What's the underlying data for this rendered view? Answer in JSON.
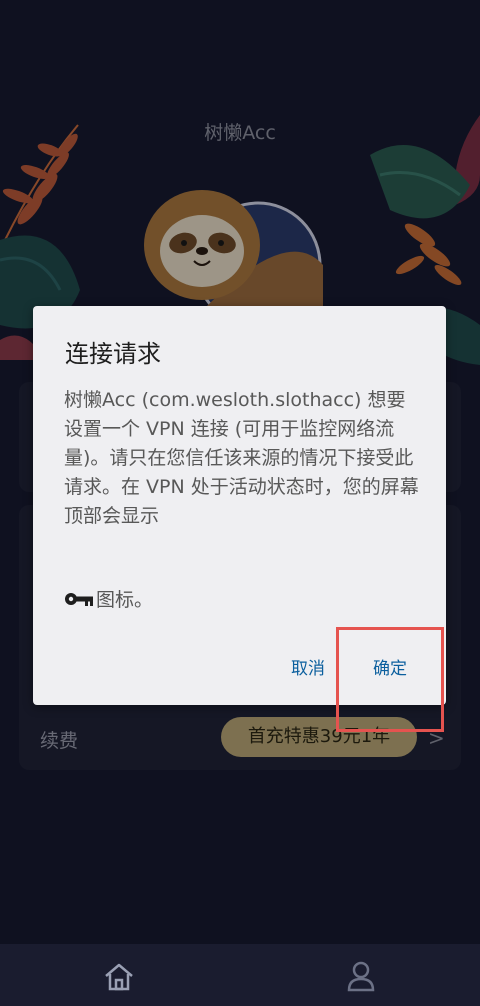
{
  "app": {
    "title": "树懒Acc"
  },
  "background": {
    "renew_label": "续费",
    "promo_label": "首充特惠39元1年"
  },
  "dialog": {
    "title": "连接请求",
    "body": "树懒Acc (com.wesloth.slothacc) 想要设置一个 VPN 连接 (可用于监控网络流量)。请只在您信任该来源的情况下接受此请求。在 VPN 处于活动状态时，您的屏幕顶部会显示",
    "note": "图标。",
    "cancel_label": "取消",
    "confirm_label": "确定"
  },
  "icons": {
    "key": "key-icon",
    "home": "home-icon",
    "profile": "profile-icon",
    "chevron": "chevron-right-icon"
  },
  "colors": {
    "background": "#171a30",
    "dialog": "#efeff2",
    "button_text": "#0b5f9e",
    "highlight": "#e5534f",
    "promo": "#b8a676"
  }
}
